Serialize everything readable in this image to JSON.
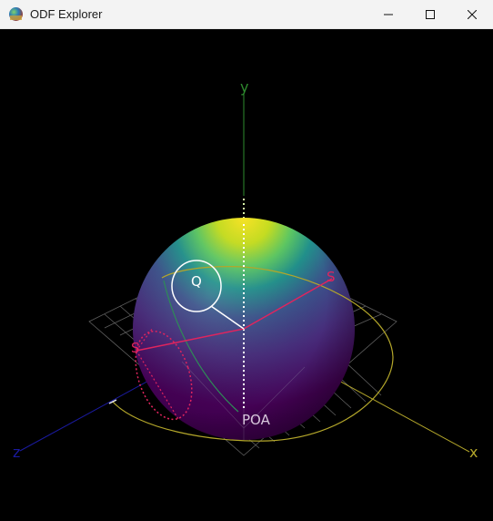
{
  "window": {
    "title": "ODF Explorer",
    "controls": {
      "minimize": "minimize-icon",
      "maximize": "maximize-icon",
      "close": "close-icon"
    }
  },
  "scene": {
    "labels": {
      "y_axis": "y",
      "x_axis": "x",
      "z_axis": "z",
      "q_point": "Q",
      "s_point_left": "S",
      "s_point_right": "S",
      "poa": "POA"
    },
    "colors": {
      "background": "#000000",
      "y_axis": "#2e8b2e",
      "x_axis": "#b3a62a",
      "z_axis": "#1a1a9e",
      "s_marker": "#e0245e",
      "q_marker": "#ffffff",
      "sphere_top": "#f4e31f",
      "sphere_mid": "#3b528b",
      "sphere_bottom": "#440154"
    }
  }
}
